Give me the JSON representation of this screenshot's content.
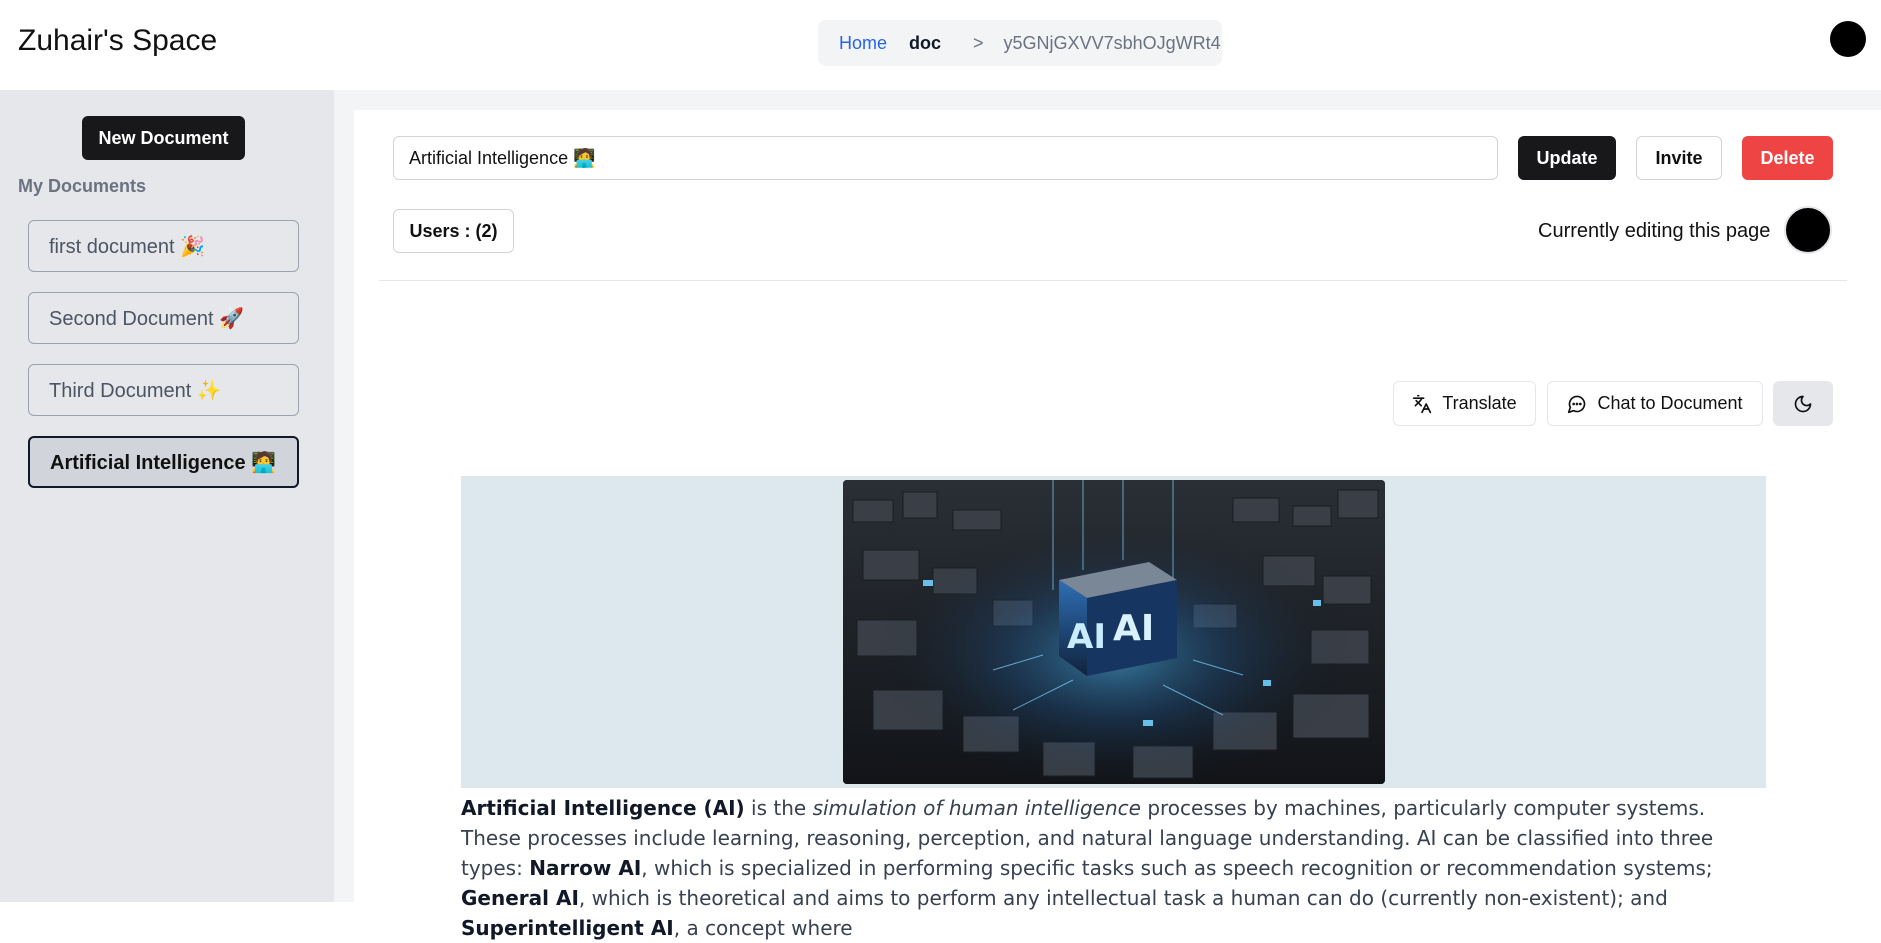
{
  "header": {
    "app_title": "Zuhair's Space",
    "breadcrumb": {
      "home": "Home",
      "section": "doc",
      "separator": ">",
      "doc_id": "y5GNjGXVV7sbhOJgWRt4"
    }
  },
  "sidebar": {
    "new_document_label": "New Document",
    "section_label": "My Documents",
    "items": [
      {
        "label": "first document 🎉",
        "active": false
      },
      {
        "label": "Second Document 🚀",
        "active": false
      },
      {
        "label": "Third Document ✨",
        "active": false
      },
      {
        "label": "Artificial Intelligence 🧑‍💻",
        "active": true
      }
    ]
  },
  "editor": {
    "title_value": "Artificial Intelligence 🧑‍💻",
    "update_label": "Update",
    "invite_label": "Invite",
    "delete_label": "Delete",
    "users_label": "Users : (2)",
    "editing_label": "Currently editing this page",
    "translate_label": "Translate",
    "chat_label": "Chat to Document",
    "image_text": "AI",
    "content": {
      "t1": "Artificial Intelligence (AI)",
      "t2": " is the ",
      "t3": "simulation of human intelligence",
      "t4": " processes by machines, particularly computer systems. These processes include learning, reasoning, perception, and natural language understanding. AI can be classified into three types: ",
      "t5": "Narrow AI",
      "t6": ", which is specialized in performing specific tasks such as speech recognition or recommendation systems; ",
      "t7": "General AI",
      "t8": ", which is theoretical and aims to perform any intellectual task a human can do (currently non-existent); and ",
      "t9": "Superintelligent AI",
      "t10": ", a concept where"
    }
  },
  "colors": {
    "primary": "#18181b",
    "danger": "#ef4444",
    "link": "#2563eb",
    "sidebar_bg": "#e5e7eb",
    "image_panel": "#dde8ee"
  }
}
